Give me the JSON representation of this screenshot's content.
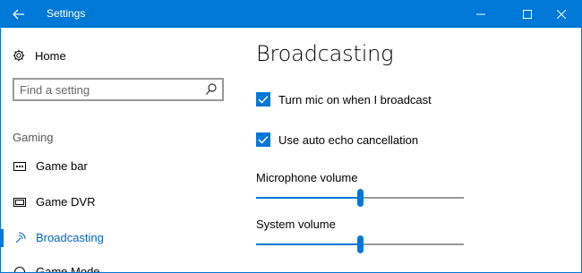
{
  "window": {
    "title": "Settings",
    "accent_color": "#0078d7"
  },
  "sidebar": {
    "home_label": "Home",
    "search": {
      "placeholder": "Find a setting",
      "value": ""
    },
    "section_label": "Gaming",
    "items": [
      {
        "label": "Game bar",
        "icon": "game-bar-icon",
        "active": false
      },
      {
        "label": "Game DVR",
        "icon": "game-dvr-icon",
        "active": false
      },
      {
        "label": "Broadcasting",
        "icon": "broadcasting-icon",
        "active": true
      },
      {
        "label": "Game Mode",
        "icon": "game-mode-icon",
        "active": false
      }
    ]
  },
  "main": {
    "title": "Broadcasting",
    "checkboxes": [
      {
        "label": "Turn mic on when I broadcast",
        "checked": true
      },
      {
        "label": "Use auto echo cancellation",
        "checked": true
      }
    ],
    "sliders": [
      {
        "label": "Microphone volume",
        "value": 0.5
      },
      {
        "label": "System volume",
        "value": 0.5
      }
    ]
  }
}
